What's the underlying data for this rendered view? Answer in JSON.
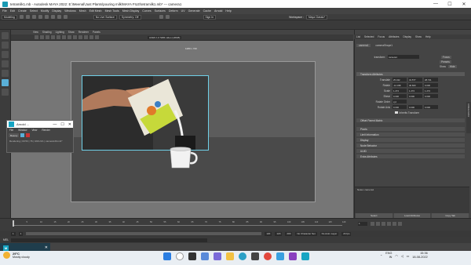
{
  "window": {
    "title": "tetramilk1.mb - Autodesk MAYA 2022: E:\\Meenal\\Just Plants\\pouring milk\\MAYA FILE\\tetramilk1.mb* --- camera1",
    "min": "—",
    "max": "☐",
    "close": "✕"
  },
  "menubar": [
    "File",
    "Edit",
    "Create",
    "Select",
    "Modify",
    "Display",
    "Windows",
    "Mesh",
    "Edit Mesh",
    "Mesh Tools",
    "Mesh Display",
    "Curves",
    "Surfaces",
    "Deform",
    "UV",
    "Generate",
    "Cache",
    "Arnold",
    "Help"
  ],
  "statusline": {
    "mode": "Modeling",
    "no_live": "No Live Surface",
    "symmetry": "Symmetry: Off",
    "signin": "Sign In",
    "workspace_label": "Workspace :",
    "workspace": "Maya Classic*"
  },
  "panel_menu": [
    "View",
    "Shading",
    "Lighting",
    "Show",
    "Renderer",
    "Panels"
  ],
  "viewport": {
    "cam_label": "1280 x 720",
    "color_space": "ACES 1.0 SDR-video (sRGB)"
  },
  "right_panel": {
    "tabs": [
      "List",
      "Selected",
      "Focus",
      "Attributes",
      "Display",
      "Show",
      "Help"
    ],
    "node_tabs": [
      "camera1",
      "cameraShape1"
    ],
    "transform_label": "transform:",
    "transform_value": "camera1",
    "focus": "Focus",
    "presets": "Presets",
    "show": "Show",
    "hide": "Hide",
    "section_transform": "Transform Attributes",
    "rows": [
      {
        "label": "Translate",
        "v": [
          "25.342",
          "31.577",
          "28.741"
        ]
      },
      {
        "label": "Rotate",
        "v": [
          "-12.338",
          "40.600",
          "0.000"
        ]
      },
      {
        "label": "Scale",
        "v": [
          "1.272",
          "1.272",
          "1.272"
        ]
      },
      {
        "label": "Shear",
        "v": [
          "0.000",
          "0.000",
          "0.000"
        ]
      }
    ],
    "rotate_order_label": "Rotate Order",
    "rotate_order": "xyz",
    "rotate_axis_label": "Rotate Axis",
    "rotate_axis": [
      "0.000",
      "0.000",
      "0.000"
    ],
    "inherits": "Inherits Transform",
    "sections": [
      "Offset Parent Matrix",
      "Pivots",
      "Limit Information",
      "Display",
      "Node Behavior",
      "UUID",
      "Extra Attributes"
    ],
    "notes_label": "Notes: camera1",
    "buttons": [
      "Select",
      "Load Attributes",
      "Copy Tab"
    ],
    "side_tab": "Attribute Editor"
  },
  "timeslider": {
    "ticks": [
      "1",
      "5",
      "10",
      "15",
      "20",
      "25",
      "30",
      "35",
      "40",
      "45",
      "50",
      "55",
      "60",
      "65",
      "70",
      "75",
      "80",
      "85",
      "90",
      "95",
      "100",
      "105",
      "110",
      "115",
      "120"
    ],
    "current": "1"
  },
  "rangebar": {
    "start": "1",
    "start2": "1",
    "end": "120",
    "end2": "120",
    "end3": "200",
    "char_set": "No Character Set",
    "anim_layer": "No Anim Layer",
    "fps": "24 fps"
  },
  "cmdline": {
    "mel": "MEL"
  },
  "arnold_window": {
    "title": "Arnold ...",
    "menu": [
      "File",
      "Window",
      "View",
      "Render"
    ],
    "tool": "Beauty",
    "status": "Rendering | 00:53 | 76 | 0/2/1/1/1 | camera1/front1*"
  },
  "toast": {
    "icon": "M"
  },
  "taskbar": {
    "temp": "29°C",
    "condition": "Mostly cloudy",
    "lang1": "ENG",
    "lang2": "IN",
    "time": "15:36",
    "date": "18-08-2022"
  },
  "colors": {
    "accent": "#5ab0d8",
    "selection": "#6fd0e8",
    "maya": "#17a5c3"
  }
}
